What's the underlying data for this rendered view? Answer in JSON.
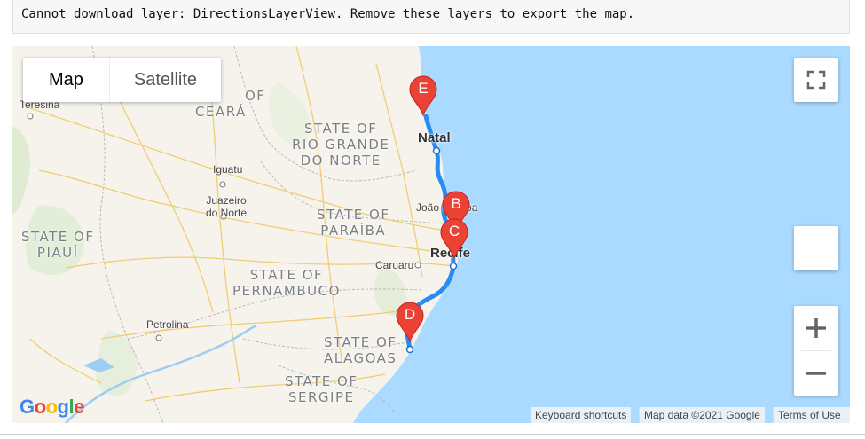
{
  "error": {
    "message": "Cannot download layer: DirectionsLayerView. Remove these layers to export the map."
  },
  "map_type": {
    "map_label": "Map",
    "satellite_label": "Satellite",
    "selected": "Map"
  },
  "controls": {
    "fullscreen_icon": "fullscreen-icon",
    "zoom_in_icon": "plus-icon",
    "zoom_out_icon": "minus-icon"
  },
  "states": {
    "ceara": "CEARÁ",
    "ceara_partial": "OF",
    "rio_grande_do_norte": [
      "STATE OF",
      "RIO GRANDE",
      "DO NORTE"
    ],
    "paraiba": [
      "STATE OF",
      "PARAÍBA"
    ],
    "piaui": [
      "STATE OF",
      "PIAUÍ"
    ],
    "pernambuco": [
      "STATE OF",
      "PERNAMBUCO"
    ],
    "alagoas": [
      "STATE OF",
      "ALAGOAS"
    ],
    "sergipe": [
      "STATE OF",
      "SERGIPE"
    ]
  },
  "cities": {
    "teresina": "Teresina",
    "natal": "Natal",
    "joao_pessoa": "João Pessoa",
    "recife": "Recife",
    "caruaru": "Caruaru",
    "iguatu": "Iguatu",
    "juazeiro": [
      "Juazeiro",
      "do Norte"
    ],
    "petrolina": "Petrolina"
  },
  "markers": {
    "e": {
      "letter": "E"
    },
    "b": {
      "letter": "B"
    },
    "c": {
      "letter": "C"
    },
    "d": {
      "letter": "D"
    }
  },
  "attribution": {
    "logo": "Google",
    "keyboard_shortcuts": "Keyboard shortcuts",
    "map_data": "Map data ©2021 Google",
    "terms": "Terms of Use"
  },
  "colors": {
    "water": "#aadaff",
    "land": "#f5f3ec",
    "route": "#2a8cf0",
    "marker": "#ea4335"
  }
}
